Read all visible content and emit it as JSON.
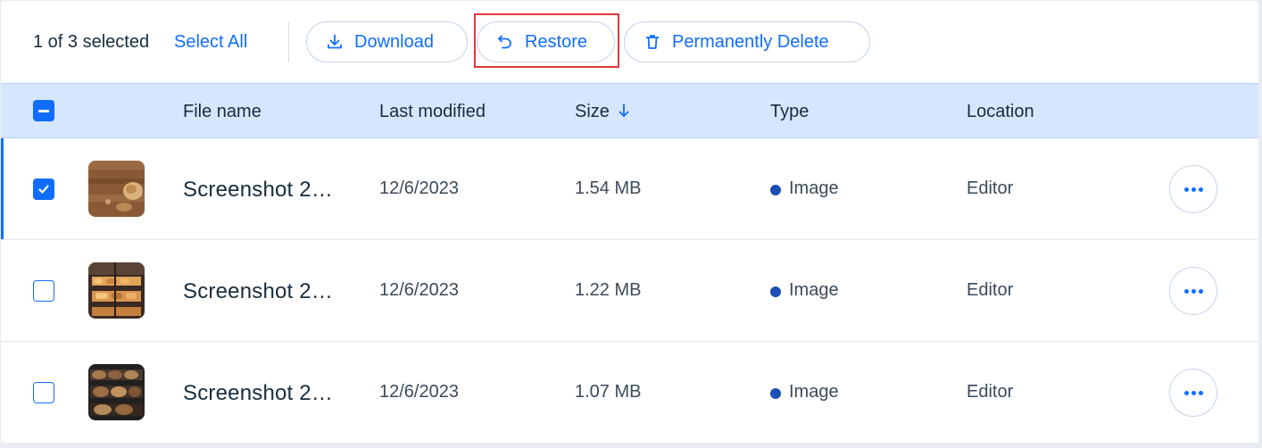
{
  "toolbar": {
    "selection_text": "1 of 3 selected",
    "select_all_label": "Select All",
    "download_label": "Download",
    "restore_label": "Restore",
    "delete_label": "Permanently Delete"
  },
  "table": {
    "columns": [
      "File name",
      "Last modified",
      "Size",
      "Type",
      "Location"
    ],
    "sort_column": "Size",
    "sort_direction": "descending",
    "rows": [
      {
        "checked": true,
        "name": "Screenshot 2…",
        "modified": "12/6/2023",
        "size": "1.54 MB",
        "type": "Image",
        "location": "Editor"
      },
      {
        "checked": false,
        "name": "Screenshot 2…",
        "modified": "12/6/2023",
        "size": "1.22 MB",
        "type": "Image",
        "location": "Editor"
      },
      {
        "checked": false,
        "name": "Screenshot 2…",
        "modified": "12/6/2023",
        "size": "1.07 MB",
        "type": "Image",
        "location": "Editor"
      }
    ]
  },
  "colors": {
    "accent": "#116dff",
    "header_bg": "#d6e6fe",
    "highlight": "#e0393e",
    "type_dot": "#1c4fb5"
  },
  "icons": [
    "download-icon",
    "undo-arrow-icon",
    "trash-icon",
    "arrow-down-icon",
    "checkmark-icon",
    "more-dots-icon"
  ]
}
